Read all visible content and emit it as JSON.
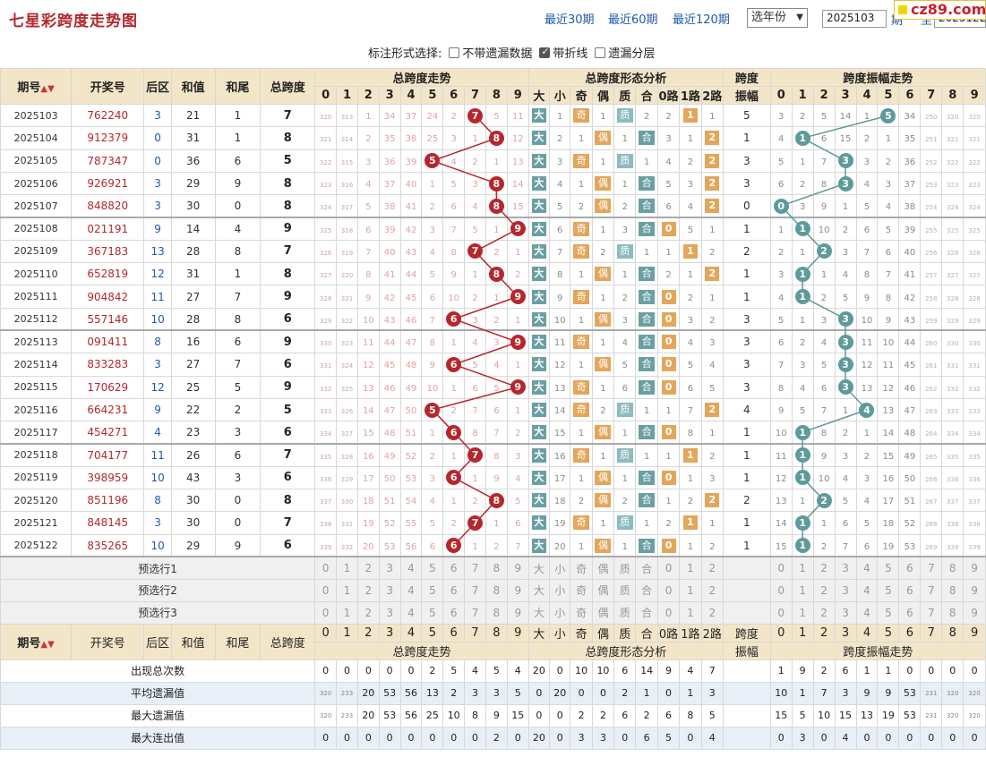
{
  "header": {
    "title": "七星彩跨度走势图",
    "nav": [
      "最近30期",
      "最近60期",
      "最近120期"
    ],
    "year_select": "选年份",
    "issue_from": "2025103",
    "issue_label": "期",
    "issue_to_label": "至",
    "issue_to": "2025122",
    "logo_text": "cz89.com"
  },
  "options": {
    "label": "标注形式选择:",
    "items": [
      {
        "label": "不带遗漏数据",
        "checked": false
      },
      {
        "label": "带折线",
        "checked": true
      },
      {
        "label": "遗漏分层",
        "checked": false
      }
    ]
  },
  "columns": {
    "issue": "期号",
    "draw": "开奖号",
    "back": "后区",
    "sum": "和值",
    "tail": "和尾",
    "span": "总跨度",
    "group_span_trend": "总跨度走势",
    "group_form": "总跨度形态分析",
    "group_amp": "跨度振幅",
    "group_amp_trend": "跨度振幅走势",
    "digits": [
      "0",
      "1",
      "2",
      "3",
      "4",
      "5",
      "6",
      "7",
      "8",
      "9"
    ],
    "form_cols": [
      "大",
      "小",
      "奇",
      "偶",
      "质",
      "合",
      "0路",
      "1路",
      "2路"
    ],
    "amp_label_1": "跨度",
    "amp_label_2": "振幅"
  },
  "rows": [
    {
      "issue": "2025103",
      "draw": "762240",
      "back": "3",
      "sum": "21",
      "tail": "1",
      "span": "7",
      "span_miss": [
        "320",
        "313",
        "1",
        "34",
        "37",
        "24",
        "2",
        "7",
        "5",
        "11"
      ],
      "form": [
        "大",
        "1",
        "奇",
        "1",
        "质",
        "2",
        "2",
        "1",
        "1"
      ],
      "form_hit": [
        0,
        2,
        4,
        7
      ],
      "amp": "5",
      "amp_miss": [
        "3",
        "2",
        "5",
        "14",
        "1",
        "5",
        "34",
        "250",
        "320",
        "320"
      ]
    },
    {
      "issue": "2025104",
      "draw": "912379",
      "back": "0",
      "sum": "31",
      "tail": "1",
      "span": "8",
      "span_miss": [
        "321",
        "314",
        "2",
        "35",
        "38",
        "25",
        "3",
        "1",
        "8",
        "12"
      ],
      "form": [
        "大",
        "2",
        "1",
        "偶",
        "1",
        "合",
        "3",
        "1",
        "2"
      ],
      "form_hit": [
        0,
        3,
        5,
        8
      ],
      "amp": "1",
      "amp_miss": [
        "4",
        "1",
        "6",
        "15",
        "2",
        "1",
        "35",
        "251",
        "321",
        "321"
      ]
    },
    {
      "issue": "2025105",
      "draw": "787347",
      "back": "0",
      "sum": "36",
      "tail": "6",
      "span": "5",
      "span_miss": [
        "322",
        "315",
        "3",
        "36",
        "39",
        "5",
        "4",
        "2",
        "1",
        "13"
      ],
      "form": [
        "大",
        "3",
        "奇",
        "1",
        "质",
        "1",
        "4",
        "2",
        "2"
      ],
      "form_hit": [
        0,
        2,
        4,
        8
      ],
      "amp": "3",
      "amp_miss": [
        "5",
        "1",
        "7",
        "3",
        "3",
        "2",
        "36",
        "252",
        "322",
        "322"
      ]
    },
    {
      "issue": "2025106",
      "draw": "926921",
      "back": "3",
      "sum": "29",
      "tail": "9",
      "span": "8",
      "span_miss": [
        "323",
        "316",
        "4",
        "37",
        "40",
        "1",
        "5",
        "3",
        "8",
        "14"
      ],
      "form": [
        "大",
        "4",
        "1",
        "偶",
        "1",
        "合",
        "5",
        "3",
        "2"
      ],
      "form_hit": [
        0,
        3,
        5,
        8
      ],
      "amp": "3",
      "amp_miss": [
        "6",
        "2",
        "8",
        "3",
        "4",
        "3",
        "37",
        "253",
        "323",
        "323"
      ]
    },
    {
      "issue": "2025107",
      "draw": "848820",
      "back": "3",
      "sum": "30",
      "tail": "0",
      "span": "8",
      "span_miss": [
        "324",
        "317",
        "5",
        "38",
        "41",
        "2",
        "6",
        "4",
        "8",
        "15"
      ],
      "form": [
        "大",
        "5",
        "2",
        "偶",
        "2",
        "合",
        "6",
        "4",
        "2"
      ],
      "form_hit": [
        0,
        3,
        5,
        8
      ],
      "amp": "0",
      "amp_miss": [
        "0",
        "3",
        "9",
        "1",
        "5",
        "4",
        "38",
        "254",
        "324",
        "324"
      ]
    },
    {
      "issue": "2025108",
      "draw": "021191",
      "back": "9",
      "sum": "14",
      "tail": "4",
      "span": "9",
      "span_miss": [
        "325",
        "318",
        "6",
        "39",
        "42",
        "3",
        "7",
        "5",
        "1",
        "9"
      ],
      "form": [
        "大",
        "6",
        "奇",
        "1",
        "3",
        "合",
        "0",
        "5",
        "1"
      ],
      "form_hit": [
        0,
        2,
        5,
        6
      ],
      "amp": "1",
      "amp_miss": [
        "1",
        "1",
        "10",
        "2",
        "6",
        "5",
        "39",
        "255",
        "325",
        "325"
      ]
    },
    {
      "issue": "2025109",
      "draw": "367183",
      "back": "13",
      "sum": "28",
      "tail": "8",
      "span": "7",
      "span_miss": [
        "326",
        "319",
        "7",
        "40",
        "43",
        "4",
        "8",
        "7",
        "2",
        "1"
      ],
      "form": [
        "大",
        "7",
        "奇",
        "2",
        "质",
        "1",
        "1",
        "1",
        "2"
      ],
      "form_hit": [
        0,
        2,
        4,
        7
      ],
      "amp": "2",
      "amp_miss": [
        "2",
        "1",
        "2",
        "3",
        "7",
        "6",
        "40",
        "256",
        "326",
        "326"
      ]
    },
    {
      "issue": "2025110",
      "draw": "652819",
      "back": "12",
      "sum": "31",
      "tail": "1",
      "span": "8",
      "span_miss": [
        "327",
        "320",
        "8",
        "41",
        "44",
        "5",
        "9",
        "1",
        "8",
        "2"
      ],
      "form": [
        "大",
        "8",
        "1",
        "偶",
        "1",
        "合",
        "2",
        "1",
        "2"
      ],
      "form_hit": [
        0,
        3,
        5,
        8
      ],
      "amp": "1",
      "amp_miss": [
        "3",
        "1",
        "1",
        "4",
        "8",
        "7",
        "41",
        "257",
        "327",
        "327"
      ]
    },
    {
      "issue": "2025111",
      "draw": "904842",
      "back": "11",
      "sum": "27",
      "tail": "7",
      "span": "9",
      "span_miss": [
        "328",
        "321",
        "9",
        "42",
        "45",
        "6",
        "10",
        "2",
        "1",
        "9"
      ],
      "form": [
        "大",
        "9",
        "奇",
        "1",
        "2",
        "合",
        "0",
        "2",
        "1"
      ],
      "form_hit": [
        0,
        2,
        5,
        6
      ],
      "amp": "1",
      "amp_miss": [
        "4",
        "1",
        "2",
        "5",
        "9",
        "8",
        "42",
        "258",
        "328",
        "328"
      ]
    },
    {
      "issue": "2025112",
      "draw": "557146",
      "back": "10",
      "sum": "28",
      "tail": "8",
      "span": "6",
      "span_miss": [
        "329",
        "322",
        "10",
        "43",
        "46",
        "7",
        "6",
        "3",
        "2",
        "1"
      ],
      "form": [
        "大",
        "10",
        "1",
        "偶",
        "3",
        "合",
        "0",
        "3",
        "2"
      ],
      "form_hit": [
        0,
        3,
        5,
        6
      ],
      "amp": "3",
      "amp_miss": [
        "5",
        "1",
        "3",
        "3",
        "10",
        "9",
        "43",
        "259",
        "329",
        "329"
      ]
    },
    {
      "issue": "2025113",
      "draw": "091411",
      "back": "8",
      "sum": "16",
      "tail": "6",
      "span": "9",
      "span_miss": [
        "330",
        "323",
        "11",
        "44",
        "47",
        "8",
        "1",
        "4",
        "3",
        "9"
      ],
      "form": [
        "大",
        "11",
        "奇",
        "1",
        "4",
        "合",
        "0",
        "4",
        "3"
      ],
      "form_hit": [
        0,
        2,
        5,
        6
      ],
      "amp": "3",
      "amp_miss": [
        "6",
        "2",
        "4",
        "3",
        "11",
        "10",
        "44",
        "260",
        "330",
        "330"
      ]
    },
    {
      "issue": "2025114",
      "draw": "833283",
      "back": "3",
      "sum": "27",
      "tail": "7",
      "span": "6",
      "span_miss": [
        "331",
        "324",
        "12",
        "45",
        "48",
        "9",
        "6",
        "5",
        "4",
        "1"
      ],
      "form": [
        "大",
        "12",
        "1",
        "偶",
        "5",
        "合",
        "0",
        "5",
        "4"
      ],
      "form_hit": [
        0,
        3,
        5,
        6
      ],
      "amp": "3",
      "amp_miss": [
        "7",
        "3",
        "5",
        "3",
        "12",
        "11",
        "45",
        "261",
        "331",
        "331"
      ]
    },
    {
      "issue": "2025115",
      "draw": "170629",
      "back": "12",
      "sum": "25",
      "tail": "5",
      "span": "9",
      "span_miss": [
        "332",
        "325",
        "13",
        "46",
        "49",
        "10",
        "1",
        "6",
        "5",
        "9"
      ],
      "form": [
        "大",
        "13",
        "奇",
        "1",
        "6",
        "合",
        "0",
        "6",
        "5"
      ],
      "form_hit": [
        0,
        2,
        5,
        6
      ],
      "amp": "3",
      "amp_miss": [
        "8",
        "4",
        "6",
        "3",
        "13",
        "12",
        "46",
        "262",
        "332",
        "332"
      ]
    },
    {
      "issue": "2025116",
      "draw": "664231",
      "back": "9",
      "sum": "22",
      "tail": "2",
      "span": "5",
      "span_miss": [
        "333",
        "326",
        "14",
        "47",
        "50",
        "5",
        "2",
        "7",
        "6",
        "1"
      ],
      "form": [
        "大",
        "14",
        "奇",
        "2",
        "质",
        "1",
        "1",
        "7",
        "2"
      ],
      "form_hit": [
        0,
        2,
        4,
        8
      ],
      "amp": "4",
      "amp_miss": [
        "9",
        "5",
        "7",
        "1",
        "4",
        "13",
        "47",
        "263",
        "333",
        "333"
      ]
    },
    {
      "issue": "2025117",
      "draw": "454271",
      "back": "4",
      "sum": "23",
      "tail": "3",
      "span": "6",
      "span_miss": [
        "334",
        "327",
        "15",
        "48",
        "51",
        "1",
        "6",
        "8",
        "7",
        "2"
      ],
      "form": [
        "大",
        "15",
        "1",
        "偶",
        "1",
        "合",
        "0",
        "8",
        "1"
      ],
      "form_hit": [
        0,
        3,
        5,
        6
      ],
      "amp": "1",
      "amp_miss": [
        "10",
        "1",
        "8",
        "2",
        "1",
        "14",
        "48",
        "264",
        "334",
        "334"
      ]
    },
    {
      "issue": "2025118",
      "draw": "704177",
      "back": "11",
      "sum": "26",
      "tail": "6",
      "span": "7",
      "span_miss": [
        "335",
        "328",
        "16",
        "49",
        "52",
        "2",
        "1",
        "7",
        "8",
        "3"
      ],
      "form": [
        "大",
        "16",
        "奇",
        "1",
        "质",
        "1",
        "1",
        "1",
        "2"
      ],
      "form_hit": [
        0,
        2,
        4,
        7
      ],
      "amp": "1",
      "amp_miss": [
        "11",
        "1",
        "9",
        "3",
        "2",
        "15",
        "49",
        "265",
        "335",
        "335"
      ]
    },
    {
      "issue": "2025119",
      "draw": "398959",
      "back": "10",
      "sum": "43",
      "tail": "3",
      "span": "6",
      "span_miss": [
        "336",
        "329",
        "17",
        "50",
        "53",
        "3",
        "6",
        "1",
        "9",
        "4"
      ],
      "form": [
        "大",
        "17",
        "1",
        "偶",
        "1",
        "合",
        "0",
        "1",
        "3"
      ],
      "form_hit": [
        0,
        3,
        5,
        6
      ],
      "amp": "1",
      "amp_miss": [
        "12",
        "1",
        "10",
        "4",
        "3",
        "16",
        "50",
        "266",
        "336",
        "336"
      ]
    },
    {
      "issue": "2025120",
      "draw": "851196",
      "back": "8",
      "sum": "30",
      "tail": "0",
      "span": "8",
      "span_miss": [
        "337",
        "330",
        "18",
        "51",
        "54",
        "4",
        "1",
        "2",
        "8",
        "5"
      ],
      "form": [
        "大",
        "18",
        "2",
        "偶",
        "2",
        "合",
        "1",
        "2",
        "2"
      ],
      "form_hit": [
        0,
        3,
        5,
        8
      ],
      "amp": "2",
      "amp_miss": [
        "13",
        "1",
        "2",
        "5",
        "4",
        "17",
        "51",
        "267",
        "337",
        "337"
      ]
    },
    {
      "issue": "2025121",
      "draw": "848145",
      "back": "3",
      "sum": "30",
      "tail": "0",
      "span": "7",
      "span_miss": [
        "338",
        "331",
        "19",
        "52",
        "55",
        "5",
        "2",
        "7",
        "1",
        "6"
      ],
      "form": [
        "大",
        "19",
        "奇",
        "1",
        "质",
        "1",
        "2",
        "1",
        "1"
      ],
      "form_hit": [
        0,
        2,
        4,
        7
      ],
      "amp": "1",
      "amp_miss": [
        "14",
        "1",
        "1",
        "6",
        "5",
        "18",
        "52",
        "268",
        "338",
        "338"
      ]
    },
    {
      "issue": "2025122",
      "draw": "835265",
      "back": "10",
      "sum": "29",
      "tail": "9",
      "span": "6",
      "span_miss": [
        "339",
        "332",
        "20",
        "53",
        "56",
        "6",
        "6",
        "1",
        "2",
        "7"
      ],
      "form": [
        "大",
        "20",
        "1",
        "偶",
        "1",
        "合",
        "0",
        "1",
        "2"
      ],
      "form_hit": [
        0,
        3,
        5,
        6
      ],
      "amp": "1",
      "amp_miss": [
        "15",
        "1",
        "2",
        "7",
        "6",
        "19",
        "53",
        "269",
        "339",
        "339"
      ]
    }
  ],
  "preselect": [
    {
      "label": "预选行1"
    },
    {
      "label": "预选行2"
    },
    {
      "label": "预选行3"
    }
  ],
  "footer": {
    "stats": [
      {
        "label": "出现总次数",
        "span": [
          "0",
          "0",
          "0",
          "0",
          "0",
          "2",
          "5",
          "4",
          "5",
          "4"
        ],
        "form": [
          "20",
          "0",
          "10",
          "10",
          "6",
          "14",
          "9",
          "4",
          "7"
        ],
        "amp": [
          "1",
          "9",
          "2",
          "6",
          "1",
          "1",
          "0",
          "0",
          "0",
          "0"
        ]
      },
      {
        "label": "平均遗漏值",
        "span": [
          "320",
          "233",
          "20",
          "53",
          "56",
          "13",
          "2",
          "3",
          "3",
          "5"
        ],
        "form": [
          "0",
          "20",
          "0",
          "0",
          "2",
          "1",
          "0",
          "1",
          "3",
          "1"
        ],
        "amp": [
          "10",
          "1",
          "7",
          "3",
          "9",
          "9",
          "53",
          "231",
          "320",
          "320"
        ]
      },
      {
        "label": "最大遗漏值",
        "span": [
          "320",
          "233",
          "20",
          "53",
          "56",
          "25",
          "10",
          "8",
          "9",
          "15"
        ],
        "form": [
          "0",
          "0",
          "2",
          "2",
          "6",
          "2",
          "6",
          "8",
          "5"
        ],
        "amp": [
          "15",
          "5",
          "10",
          "15",
          "13",
          "19",
          "53",
          "231",
          "320",
          "320"
        ]
      },
      {
        "label": "最大连出值",
        "span": [
          "0",
          "0",
          "0",
          "0",
          "0",
          "0",
          "0",
          "0",
          "2",
          "0"
        ],
        "form": [
          "20",
          "0",
          "3",
          "3",
          "0",
          "6",
          "5",
          "0",
          "4"
        ],
        "amp": [
          "0",
          "3",
          "0",
          "4",
          "0",
          "0",
          "0",
          "0",
          "0",
          "0"
        ]
      }
    ]
  }
}
